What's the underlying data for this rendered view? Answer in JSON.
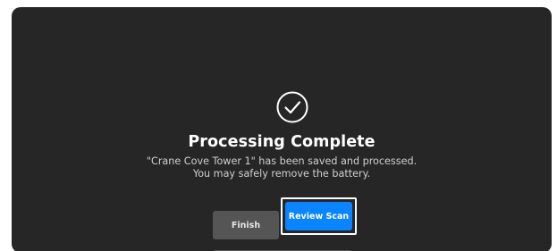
{
  "dialog": {
    "icon": "check-circle-icon",
    "title": "Processing Complete",
    "message_line1": "\"Crane Cove Tower 1\" has been saved and processed.",
    "message_line2": "You may safely remove the battery."
  },
  "buttons": {
    "finish_label": "Finish",
    "review_label": "Review Scan"
  },
  "colors": {
    "background": "#262626",
    "primary": "#0a84ff",
    "secondary": "#555555",
    "text": "#ffffff"
  }
}
